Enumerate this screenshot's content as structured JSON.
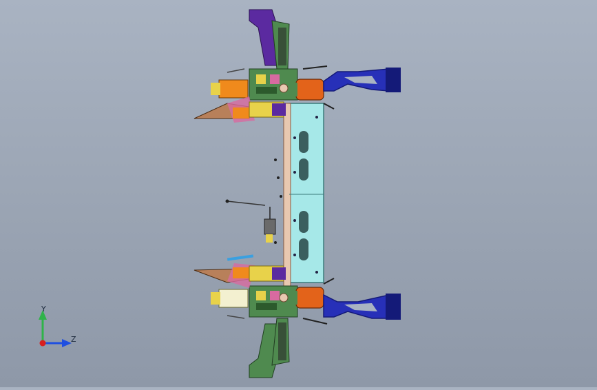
{
  "viewport": {
    "background_top": "#a9b3c2",
    "background_bottom": "#8e98a8"
  },
  "triad": {
    "y_label": "Y",
    "z_label": "Z",
    "y_color": "#2fb34a",
    "z_color": "#1f4fe0",
    "x_color": "#d81f1f"
  },
  "model": {
    "colors": {
      "arm": "#2730b8",
      "arm_dark": "#141a78",
      "beam": "#a6e8e8",
      "beam_edge": "#3b7a7a",
      "hub": "#e3631a",
      "bracket_purple": "#5b2aa0",
      "bracket_green": "#4f8a4f",
      "yellow": "#e8d24a",
      "pink": "#d86aa0",
      "orange": "#f08a1c",
      "brown": "#b8805a",
      "rod": "#e8c8b0"
    }
  }
}
